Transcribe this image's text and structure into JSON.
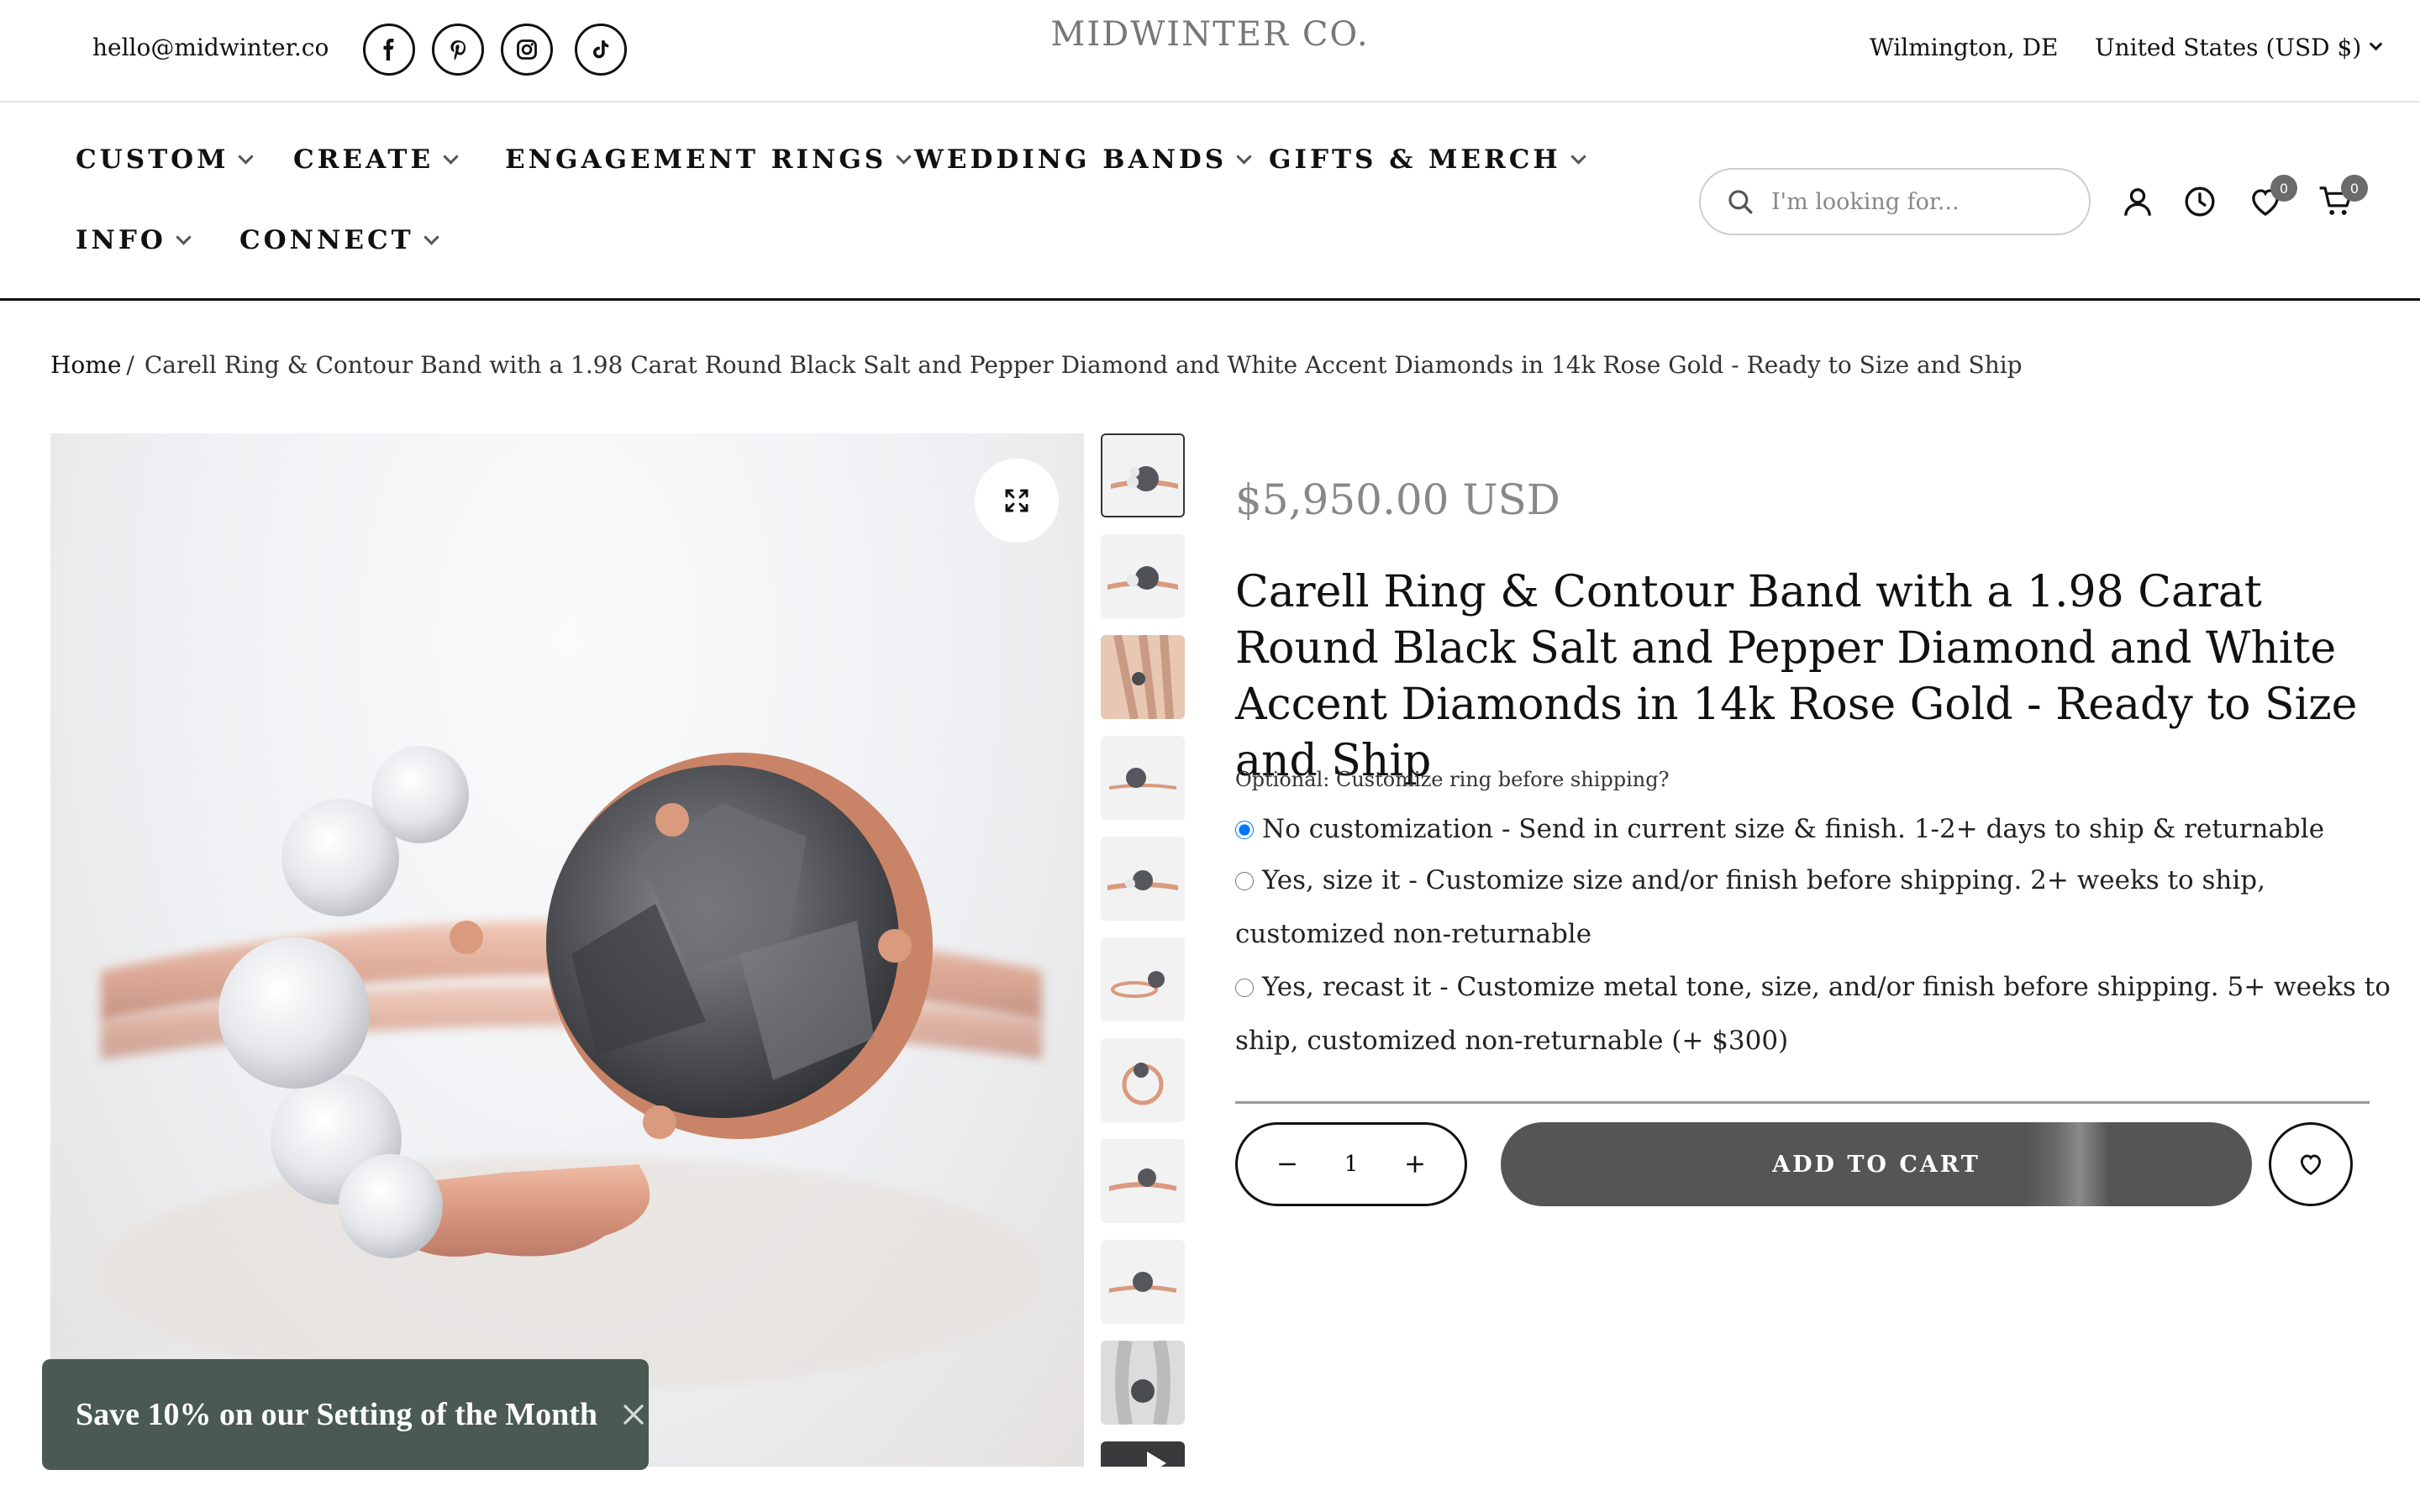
{
  "header": {
    "email": "hello@midwinter.co",
    "social_icons": [
      "facebook-icon",
      "pinterest-icon",
      "instagram-icon",
      "tiktok-icon"
    ],
    "logo": "MIDWINTER CO.",
    "location": "Wilmington, DE",
    "currency": "United States (USD $)"
  },
  "nav": {
    "items": [
      {
        "label": "CUSTOM"
      },
      {
        "label": "CREATE"
      },
      {
        "label": "ENGAGEMENT RINGS"
      },
      {
        "label": "WEDDING BANDS"
      },
      {
        "label": "GIFTS & MERCH"
      },
      {
        "label": "INFO"
      },
      {
        "label": "CONNECT"
      }
    ],
    "search_placeholder": "I'm looking for...",
    "wishlist_count": "0",
    "cart_count": "0"
  },
  "breadcrumb": {
    "home": "Home",
    "separator": "/",
    "current": "Carell Ring & Contour Band with a 1.98 Carat Round Black Salt and Pepper Diamond and White Accent Diamonds in 14k Rose Gold - Ready to Size and Ship"
  },
  "product": {
    "price": "$5,950.00 USD",
    "title": "Carell Ring & Contour Band with a 1.98 Carat Round Black Salt and Pepper Diamond and White Accent Diamonds in 14k Rose Gold - Ready to Size and Ship",
    "options_label": "Optional: Customize ring before shipping?",
    "options": [
      {
        "label": "No customization - Send in current size & finish. 1-2+ days to ship & returnable",
        "selected": true
      },
      {
        "label": "Yes, size it - Customize size and/or finish before shipping. 2+ weeks to ship, customized non-returnable",
        "selected": false
      },
      {
        "label": "Yes, recast it - Customize metal tone, size, and/or finish before shipping. 5+ weeks to ship, customized non-returnable (+ $300)",
        "selected": false
      }
    ],
    "quantity": "1",
    "add_to_cart": "ADD TO CART"
  },
  "promo": {
    "text": "Save 10% on our Setting of the Month"
  },
  "colors": {
    "rose_gold": "#d9957a",
    "diamond_dark": "#4a4c50",
    "promo_bg": "#4a5a52",
    "cart_button": "#555555",
    "price": "#888888"
  }
}
